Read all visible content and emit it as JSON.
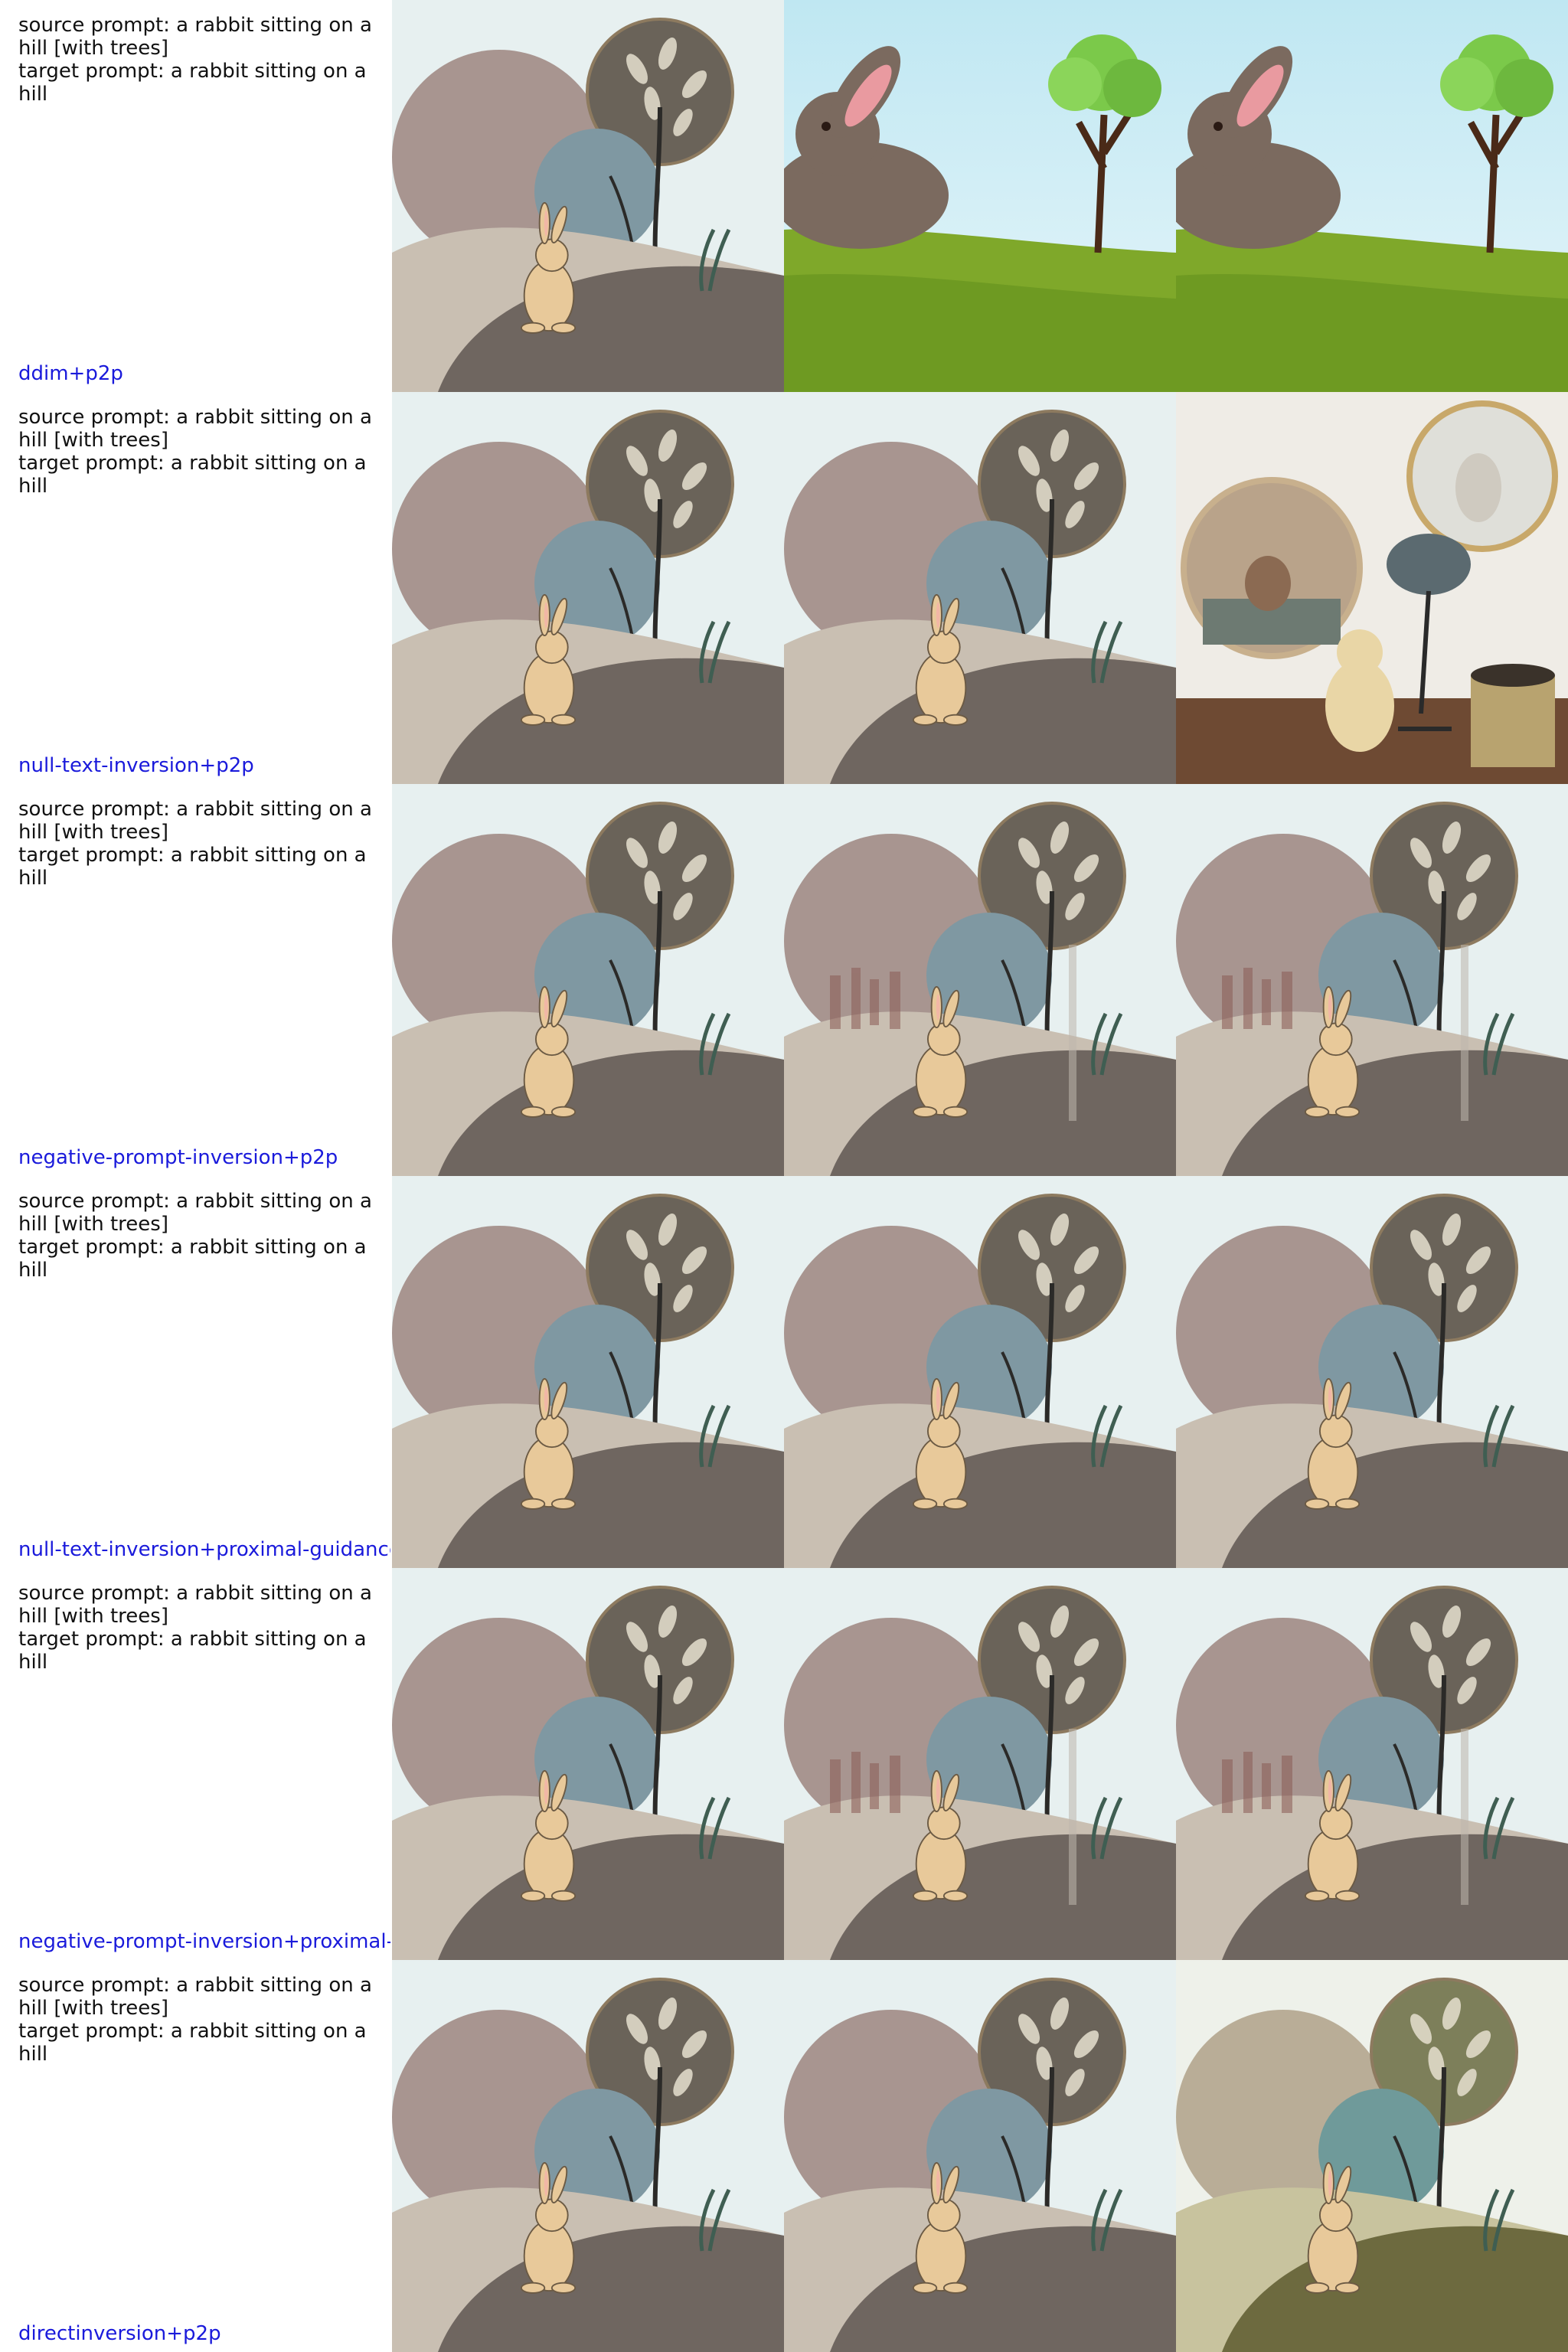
{
  "colors": {
    "method_label": "#1a1adb",
    "prompt_text": "#111111",
    "sky": "#e7f0f0",
    "hill_dark": "#6f6660",
    "hill_light": "#c9bfb2",
    "moon": "#a89590",
    "blue_circle": "#7f98a2",
    "tree_circle": "#6a6359",
    "rabbit": "#e8c99a"
  },
  "rows": [
    {
      "source_prompt": "source prompt: a rabbit sitting on a hill [with trees]",
      "target_prompt": "target prompt: a rabbit sitting on a hill",
      "method": "ddim+p2p",
      "cells": [
        {
          "image": "source-illustration-rabbit-on-hill"
        },
        {
          "image": "cartoon-brown-rabbit-green-hill-tree"
        },
        {
          "image": "cartoon-brown-rabbit-green-hill-tree"
        }
      ]
    },
    {
      "source_prompt": "source prompt: a rabbit sitting on a hill [with trees]",
      "target_prompt": "target prompt: a rabbit sitting on a hill",
      "method": "null-text-inversion+p2p",
      "cells": [
        {
          "image": "source-illustration-rabbit-on-hill"
        },
        {
          "image": "reconstructed-illustration-rabbit-on-hill"
        },
        {
          "image": "photo-rabbit-figurines-round-frames-and-lamp"
        }
      ]
    },
    {
      "source_prompt": "source prompt: a rabbit sitting on a hill [with trees]",
      "target_prompt": "target prompt: a rabbit sitting on a hill",
      "method": "negative-prompt-inversion+p2p",
      "cells": [
        {
          "image": "source-illustration-rabbit-on-hill"
        },
        {
          "image": "smudged-illustration-rabbit-on-hill"
        },
        {
          "image": "smudged-illustration-rabbit-on-hill"
        }
      ]
    },
    {
      "source_prompt": "source prompt: a rabbit sitting on a hill [with trees]",
      "target_prompt": "target prompt: a rabbit sitting on a hill",
      "method": "null-text-inversion+proximal-guidance",
      "cells": [
        {
          "image": "source-illustration-rabbit-on-hill"
        },
        {
          "image": "reconstructed-illustration-rabbit-on-hill"
        },
        {
          "image": "reconstructed-illustration-rabbit-on-hill"
        }
      ]
    },
    {
      "source_prompt": "source prompt: a rabbit sitting on a hill [with trees]",
      "target_prompt": "target prompt: a rabbit sitting on a hill",
      "method": "negative-prompt-inversion+proximal-g",
      "cells": [
        {
          "image": "source-illustration-rabbit-on-hill"
        },
        {
          "image": "smudged-illustration-rabbit-on-hill"
        },
        {
          "image": "smudged-illustration-rabbit-on-hill"
        }
      ]
    },
    {
      "source_prompt": "source prompt: a rabbit sitting on a hill [with trees]",
      "target_prompt": "target prompt: a rabbit sitting on a hill",
      "method": "directinversion+p2p",
      "cells": [
        {
          "image": "source-illustration-rabbit-on-hill"
        },
        {
          "image": "reconstructed-illustration-rabbit-on-hill"
        },
        {
          "image": "olive-tinted-illustration-rabbit-on-hill"
        }
      ]
    }
  ]
}
